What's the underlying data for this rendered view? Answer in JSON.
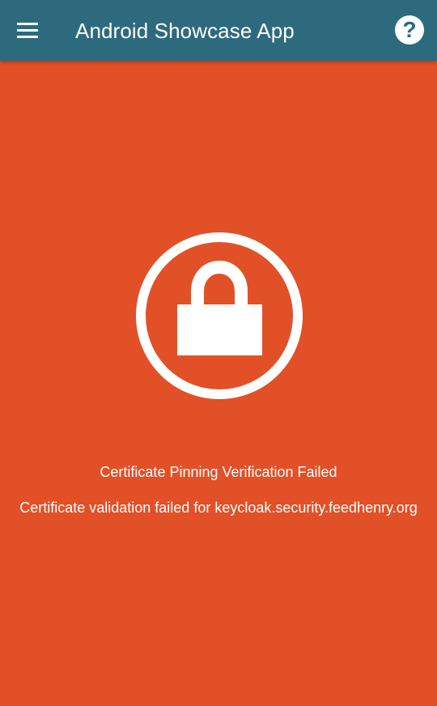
{
  "app_bar": {
    "title": "Android Showcase App",
    "menu_icon": "hamburger-menu-icon",
    "help_icon": "help-question-icon",
    "help_glyph": "?",
    "background_color": "#2d6a7e"
  },
  "screen": {
    "background_color": "#e25027",
    "lock_icon": "padlock-icon"
  },
  "message": {
    "title": "Certificate Pinning Verification Failed",
    "detail": "Certificate validation failed for keycloak.security.feedhenry.org"
  }
}
